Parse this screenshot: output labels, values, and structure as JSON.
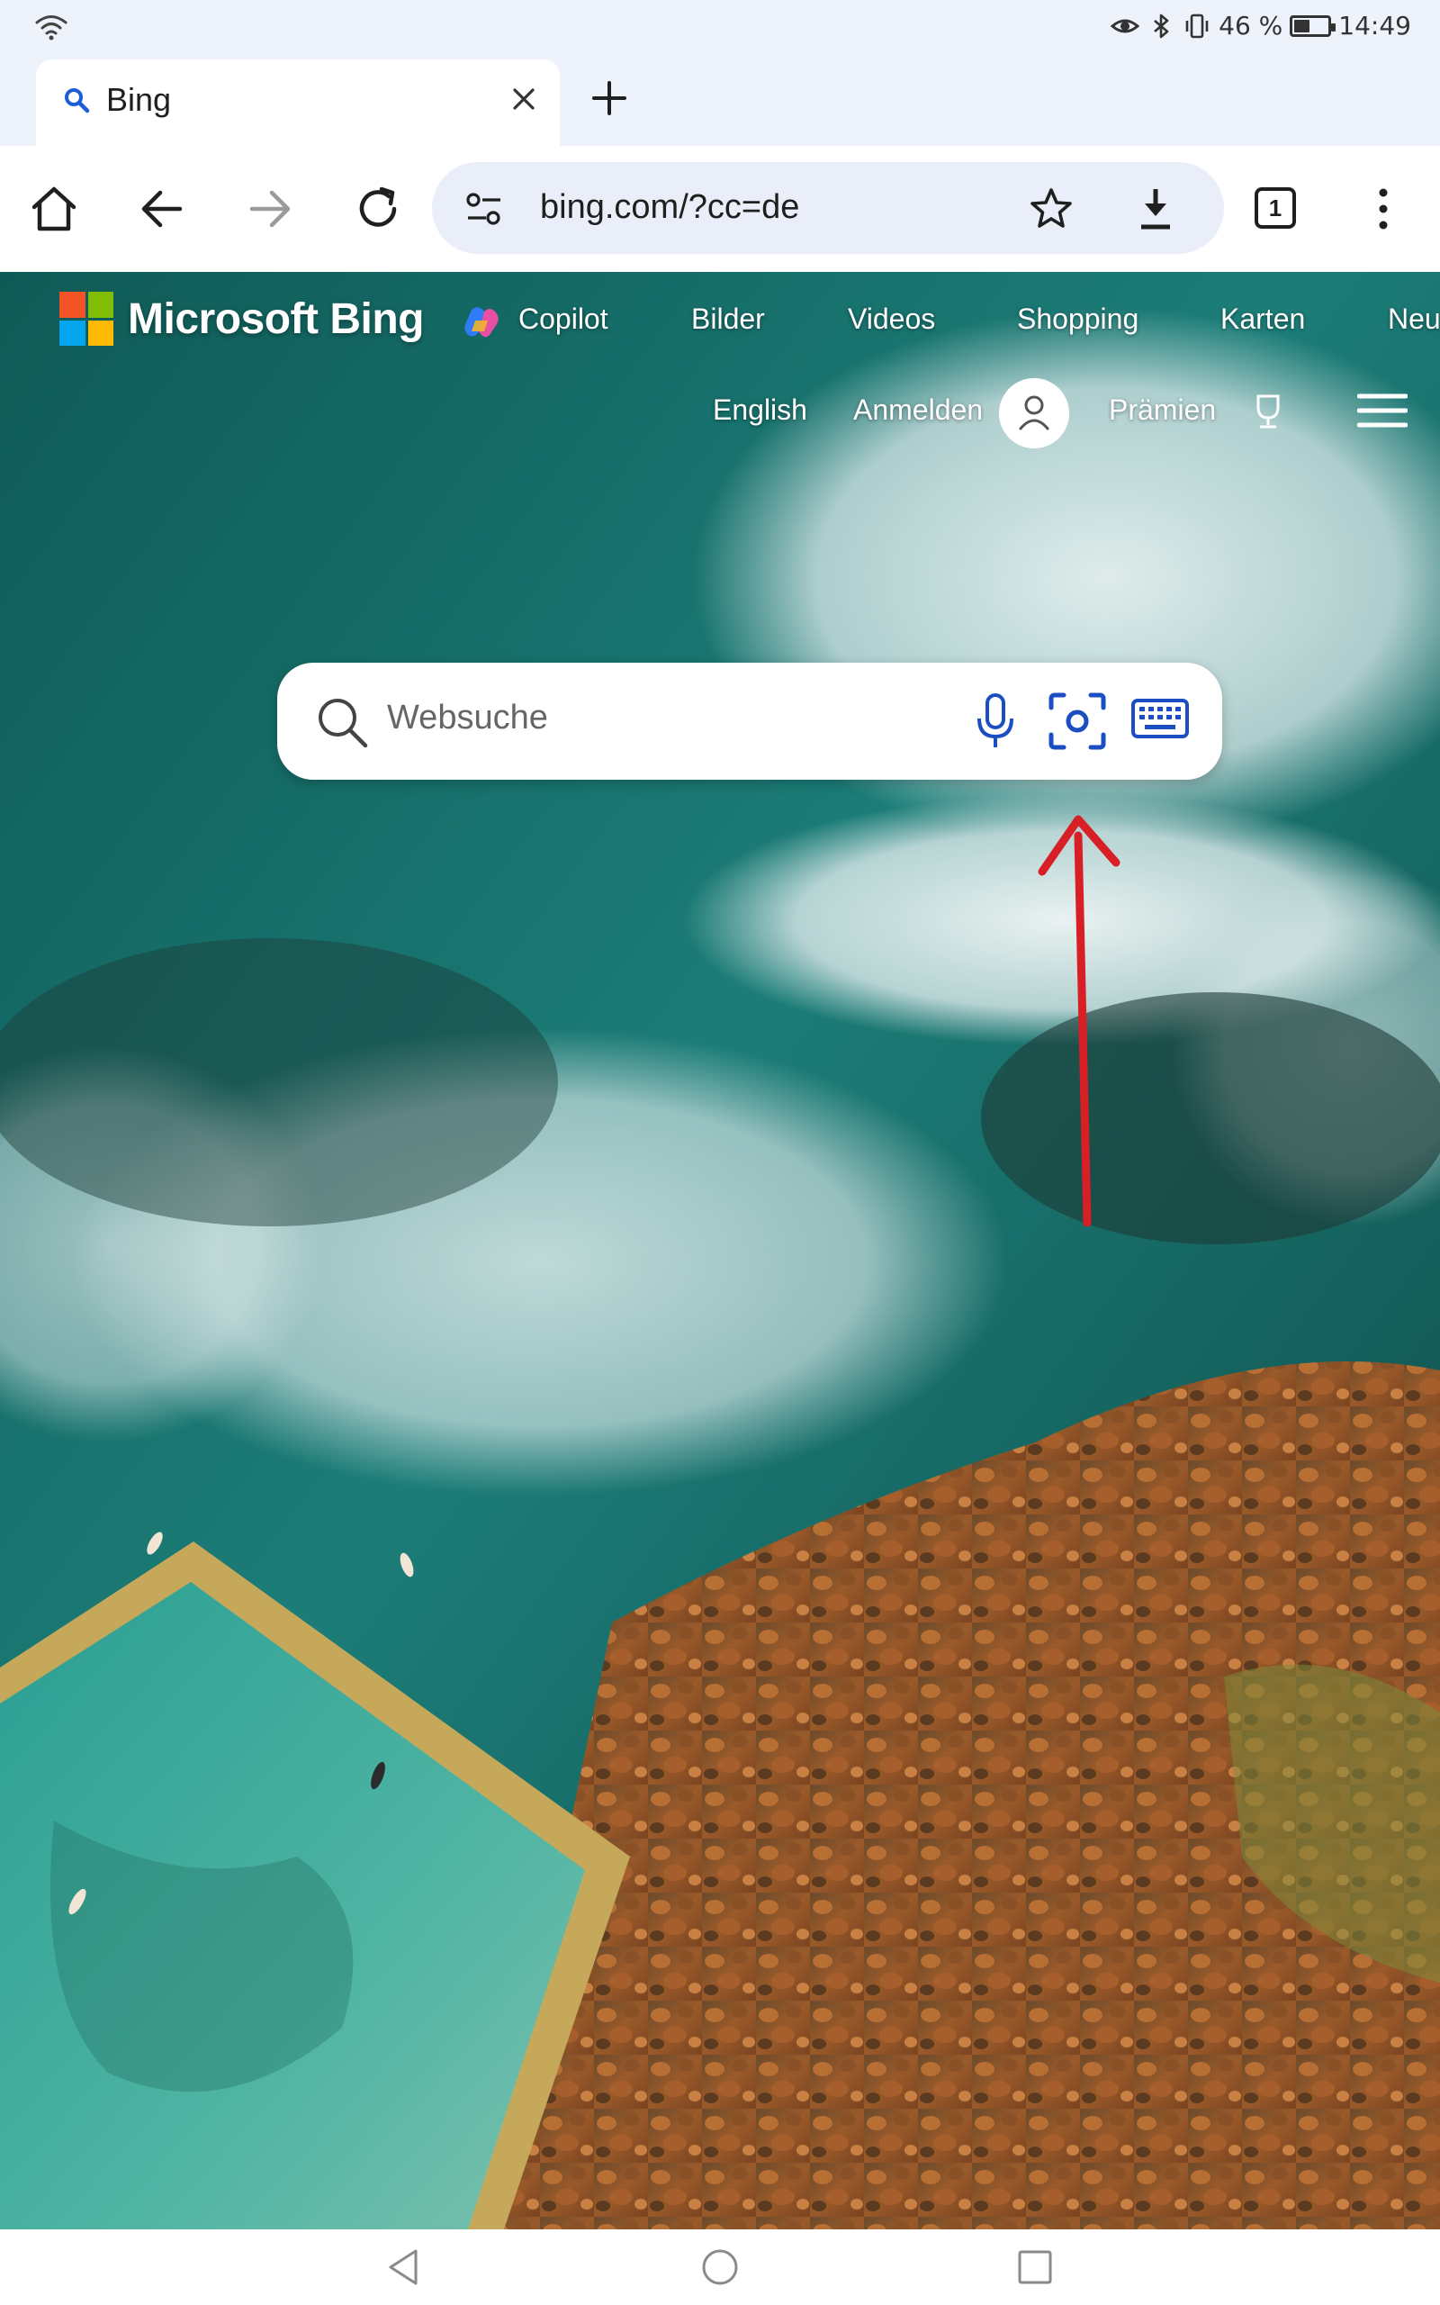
{
  "status_bar": {
    "battery_percent": "46 %",
    "battery_level": 0.46,
    "time": "14:49",
    "icons": [
      "wifi-icon",
      "eye-icon",
      "bluetooth-icon",
      "vibrate-icon",
      "battery-icon"
    ]
  },
  "browser": {
    "tab": {
      "title": "Bing",
      "icon": "search-icon"
    },
    "tab_count": "1",
    "url": "bing.com/?cc=de",
    "toolbar_icons": [
      "home-icon",
      "back-icon",
      "forward-icon",
      "reload-icon",
      "site-settings-icon",
      "star-icon",
      "download-icon",
      "tab-switcher-icon",
      "more-icon"
    ]
  },
  "bing": {
    "brand": "Microsoft Bing",
    "logo_colors": [
      "#f35325",
      "#81bc06",
      "#05a6f0",
      "#ffba08"
    ],
    "nav": [
      "Copilot",
      "Bilder",
      "Videos",
      "Shopping",
      "Karten",
      "Neu"
    ],
    "language": "English",
    "signin": "Anmelden",
    "rewards": "Prämien",
    "search": {
      "placeholder": "Websuche",
      "icons": [
        "microphone-icon",
        "visual-search-icon",
        "keyboard-icon"
      ]
    }
  },
  "annotation": {
    "arrow_color": "#d81f26",
    "points_to": "visual-search-icon"
  },
  "system_nav": [
    "back-triangle-icon",
    "home-circle-icon",
    "recents-square-icon"
  ]
}
